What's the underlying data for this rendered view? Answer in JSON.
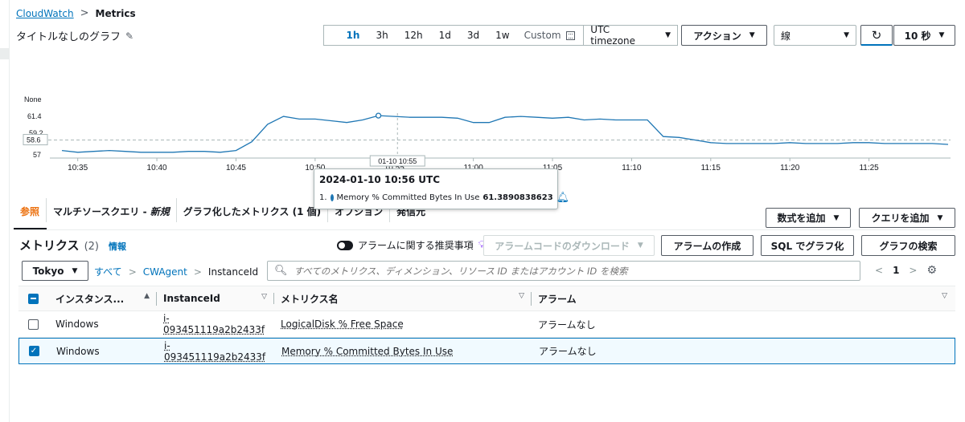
{
  "breadcrumb": {
    "root": "CloudWatch",
    "current": "Metrics"
  },
  "graph": {
    "title": "タイトルなしのグラフ"
  },
  "toolbar": {
    "ranges": [
      "1h",
      "3h",
      "12h",
      "1d",
      "3d",
      "1w"
    ],
    "active_range": "1h",
    "custom": "Custom",
    "timezone": "UTC timezone",
    "actions": "アクション",
    "chart_type": "線",
    "refresh": "10 秒"
  },
  "chart_data": {
    "type": "line",
    "y_ticks": [
      "None",
      "61.4",
      "58.6",
      "57"
    ],
    "y_extra": "59.2",
    "x": [
      "10:34",
      "10:35",
      "10:36",
      "10:37",
      "10:38",
      "10:39",
      "10:40",
      "10:41",
      "10:42",
      "10:43",
      "10:44",
      "10:45",
      "10:46",
      "10:47",
      "10:48",
      "10:49",
      "10:50",
      "10:51",
      "10:52",
      "10:53",
      "10:54",
      "10:55",
      "10:56",
      "10:57",
      "10:58",
      "10:59",
      "11:00",
      "11:01",
      "11:02",
      "11:03",
      "11:04",
      "11:05",
      "11:06",
      "11:07",
      "11:08",
      "11:09",
      "11:10",
      "11:11",
      "11:12",
      "11:13",
      "11:14",
      "11:15",
      "11:16",
      "11:17",
      "11:18",
      "11:19",
      "11:20",
      "11:21",
      "11:22",
      "11:23",
      "11:24",
      "11:25",
      "11:26",
      "11:27",
      "11:28",
      "11:29",
      "11:30"
    ],
    "x_labels": [
      "10:35",
      "10:40",
      "10:45",
      "10:50",
      "10:55",
      "11:00",
      "11:05",
      "11:10",
      "11:15",
      "11:20",
      "11:25"
    ],
    "series": [
      {
        "name": "Memory % Committed Bytes In Use",
        "color": "#1f77b4",
        "values": [
          57.4,
          57.2,
          57.3,
          57.4,
          57.3,
          57.2,
          57.2,
          57.2,
          57.3,
          57.3,
          57.2,
          57.4,
          58.4,
          60.4,
          61.3,
          61.0,
          61.0,
          60.8,
          60.6,
          60.9,
          61.39,
          61.3,
          61.2,
          61.2,
          61.2,
          61.1,
          60.6,
          60.6,
          61.2,
          61.3,
          61.2,
          61.1,
          61.2,
          60.9,
          61.0,
          60.9,
          60.9,
          60.9,
          59.0,
          58.9,
          58.6,
          58.3,
          58.2,
          58.2,
          58.2,
          58.2,
          58.3,
          58.2,
          58.2,
          58.2,
          58.3,
          58.3,
          58.2,
          58.2,
          58.2,
          58.2,
          58.1
        ]
      }
    ],
    "ylim": [
      57,
      61.4
    ],
    "threshold": 58.6,
    "crosshair_label": "01-10 10:55",
    "grid": false,
    "legend": "none"
  },
  "tooltip": {
    "title": "2024-01-10 10:56 UTC",
    "index": "1.",
    "metric": "Memory % Committed Bytes In Use",
    "value": "61.3890838623"
  },
  "tabs": [
    {
      "label": "参照",
      "active": true
    },
    {
      "label": "マルチソースクエリ - ",
      "em": "新規"
    },
    {
      "label": "グラフ化したメトリクス (1 個)"
    },
    {
      "label": "オプション"
    },
    {
      "label": "発信元"
    }
  ],
  "right_actions": {
    "add_math": "数式を追加",
    "add_query": "クエリを追加"
  },
  "metrics": {
    "heading": "メトリクス",
    "count": "(2)",
    "info": "情報",
    "alarm_toggle": "アラームに関する推奨事項",
    "download": "アラームコードのダウンロード",
    "create_alarm": "アラームの作成",
    "sql_graph": "SQL でグラフ化",
    "graph_search": "グラフの検索"
  },
  "filter": {
    "region": "Tokyo",
    "crumbs": [
      "すべて",
      "CWAgent",
      "InstanceId"
    ],
    "search_placeholder": "すべてのメトリクス、ディメンション、リソース ID またはアカウント ID を検索",
    "page": "1"
  },
  "table": {
    "headers": [
      "インスタンス...",
      "InstanceId",
      "メトリクス名",
      "アラーム"
    ],
    "rows": [
      {
        "instance": "Windows",
        "id": "i-093451119a2b2433f",
        "metric": "LogicalDisk % Free Space",
        "alarm": "アラームなし",
        "checked": false
      },
      {
        "instance": "Windows",
        "id": "i-093451119a2b2433f",
        "metric": "Memory % Committed Bytes In Use",
        "alarm": "アラームなし",
        "checked": true
      }
    ]
  }
}
